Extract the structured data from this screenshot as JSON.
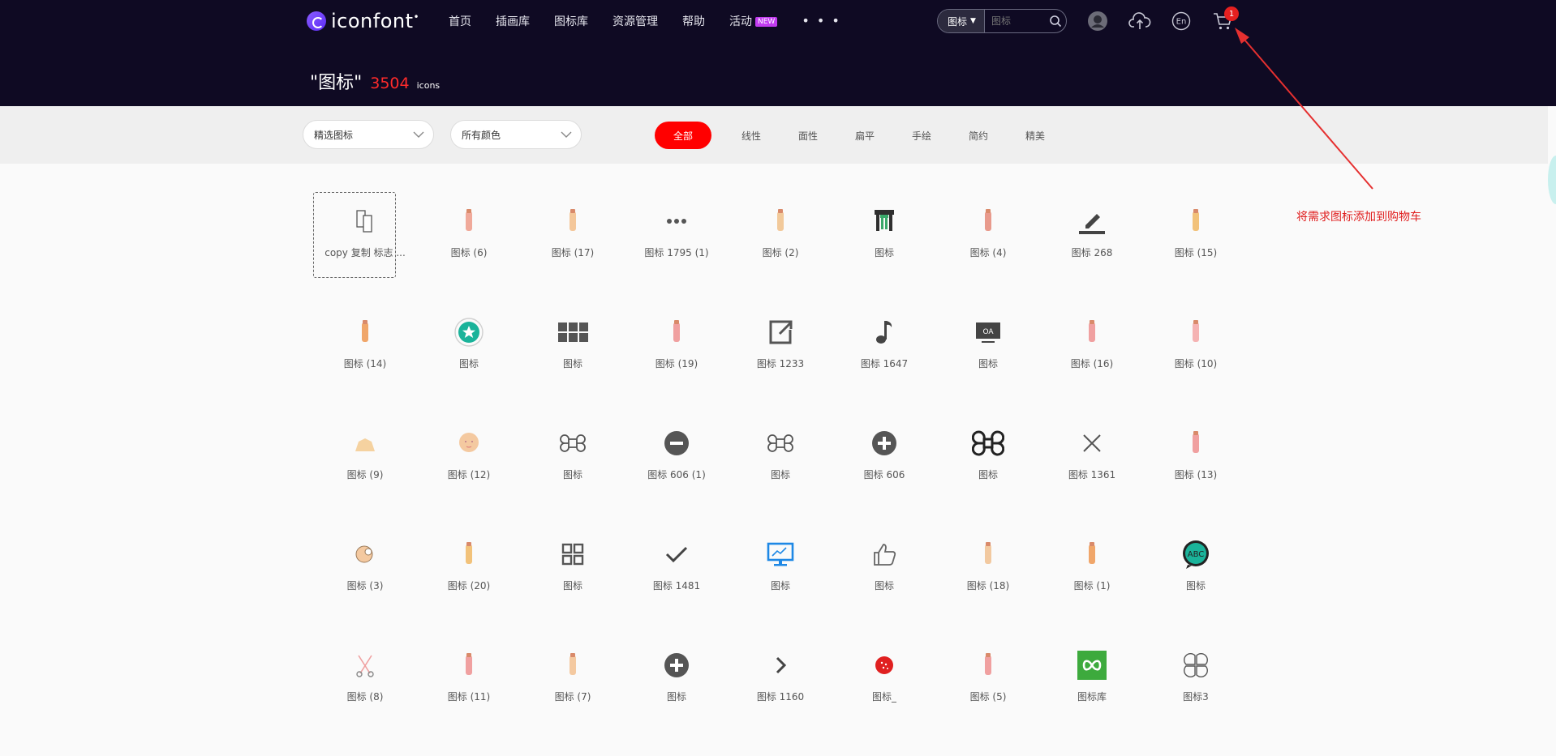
{
  "header": {
    "logo_text": "iconfont",
    "nav": [
      {
        "label": "首页"
      },
      {
        "label": "插画库"
      },
      {
        "label": "图标库"
      },
      {
        "label": "资源管理"
      },
      {
        "label": "帮助"
      },
      {
        "label": "活动",
        "badge": "NEW"
      }
    ],
    "more": "• • •",
    "search": {
      "type": "图标",
      "placeholder": "图标"
    },
    "icons": [
      "user-avatar-icon",
      "upload-cloud-icon",
      "language-en-icon",
      "cart-icon"
    ],
    "language_label": "En",
    "cart_count": "1"
  },
  "page_title": {
    "query": "\"图标\"",
    "count": "3504",
    "unit": "icons"
  },
  "filters": {
    "type_select": "精选图标",
    "color_select": "所有颜色",
    "tabs": [
      "全部",
      "线性",
      "面性",
      "扁平",
      "手绘",
      "简约",
      "精美"
    ],
    "active_tab": "全部"
  },
  "icon_grid": [
    {
      "label": "copy 复制 标志 ...",
      "icon": "copy-icon",
      "color": "#555555"
    },
    {
      "label": "图标 (6)",
      "icon": "brush-stroke-icon",
      "color": "#f0a99a"
    },
    {
      "label": "图标 (17)",
      "icon": "foundation-bottle-icon",
      "color": "#f4c79a"
    },
    {
      "label": "图标 1795 (1)",
      "icon": "more-dots-icon",
      "color": "#555555"
    },
    {
      "label": "图标 (2)",
      "icon": "perfume-bottle-icon",
      "color": "#f2c99a"
    },
    {
      "label": "图标",
      "icon": "gate-icon",
      "color": "#2f2f2f"
    },
    {
      "label": "图标 (4)",
      "icon": "cosmetic-bag-icon",
      "color": "#e89a8c"
    },
    {
      "label": "图标 268",
      "icon": "edit-pen-icon",
      "color": "#444444"
    },
    {
      "label": "图标 (15)",
      "icon": "makeup-pencil-icon",
      "color": "#f2c27a"
    },
    {
      "label": "图标 (14)",
      "icon": "nail-polish-icon",
      "color": "#f0a66a"
    },
    {
      "label": "图标",
      "icon": "star-badge-icon",
      "color": "#1ab39a"
    },
    {
      "label": "图标",
      "icon": "grid-blocks-icon",
      "color": "#555555"
    },
    {
      "label": "图标 (19)",
      "icon": "eyelash-curler-icon",
      "color": "#f0a0a0"
    },
    {
      "label": "图标 1233",
      "icon": "external-link-icon",
      "color": "#555555"
    },
    {
      "label": "图标 1647",
      "icon": "music-note-icon",
      "color": "#444444"
    },
    {
      "label": "图标",
      "icon": "oa-screen-icon",
      "color": "#444444"
    },
    {
      "label": "图标 (16)",
      "icon": "lip-gloss-icon",
      "color": "#f0a0a0"
    },
    {
      "label": "图标 (10)",
      "icon": "cream-tube-icon",
      "color": "#f5b3b3"
    },
    {
      "label": "图标 (9)",
      "icon": "hat-box-icon",
      "color": "#f5d2a0"
    },
    {
      "label": "图标 (12)",
      "icon": "face-icon",
      "color": "#f4c9a0"
    },
    {
      "label": "图标",
      "icon": "command-outline-icon",
      "color": "#555555"
    },
    {
      "label": "图标 606 (1)",
      "icon": "minus-circle-icon",
      "color": "#555555"
    },
    {
      "label": "图标",
      "icon": "command-small-icon",
      "color": "#555555"
    },
    {
      "label": "图标 606",
      "icon": "plus-circle-icon",
      "color": "#555555"
    },
    {
      "label": "图标",
      "icon": "command-bold-icon",
      "color": "#222222"
    },
    {
      "label": "图标 1361",
      "icon": "close-x-icon",
      "color": "#555555"
    },
    {
      "label": "图标 (13)",
      "icon": "lipstick-tall-icon",
      "color": "#f0a0a0"
    },
    {
      "label": "图标 (3)",
      "icon": "powder-puff-icon",
      "color": "#f4c9a0"
    },
    {
      "label": "图标 (20)",
      "icon": "tweezers-icon",
      "color": "#f2c27a"
    },
    {
      "label": "图标",
      "icon": "grid-four-icon",
      "color": "#555555"
    },
    {
      "label": "图标 1481",
      "icon": "check-icon",
      "color": "#444444"
    },
    {
      "label": "图标",
      "icon": "monitor-icon",
      "color": "#1e88e5"
    },
    {
      "label": "图标",
      "icon": "thumbs-up-icon",
      "color": "#666666"
    },
    {
      "label": "图标 (18)",
      "icon": "false-eyelash-icon",
      "color": "#f2c9a0"
    },
    {
      "label": "图标 (1)",
      "icon": "lipstick-icon",
      "color": "#f0a66a"
    },
    {
      "label": "图标",
      "icon": "abc-chat-icon",
      "color": "#1ab39a"
    },
    {
      "label": "图标 (8)",
      "icon": "scissors-icon",
      "color": "#f0a0a0"
    },
    {
      "label": "图标 (11)",
      "icon": "makeup-brush-icon",
      "color": "#f0a0a0"
    },
    {
      "label": "图标 (7)",
      "icon": "cosmetic-pad-icon",
      "color": "#f4c9a0"
    },
    {
      "label": "图标",
      "icon": "plus-circle-dark-icon",
      "color": "#555555"
    },
    {
      "label": "图标 1160",
      "icon": "chevron-right-icon",
      "color": "#444444"
    },
    {
      "label": "图标_",
      "icon": "red-ball-icon",
      "color": "#e02020"
    },
    {
      "label": "图标 (5)",
      "icon": "hand-cream-icon",
      "color": "#f0a0a0"
    },
    {
      "label": "图标库",
      "icon": "infinity-square-icon",
      "color": "#3daa3d"
    },
    {
      "label": "图标3",
      "icon": "clover-outline-icon",
      "color": "#555555"
    }
  ],
  "annotation": "将需求图标添加到购物车"
}
